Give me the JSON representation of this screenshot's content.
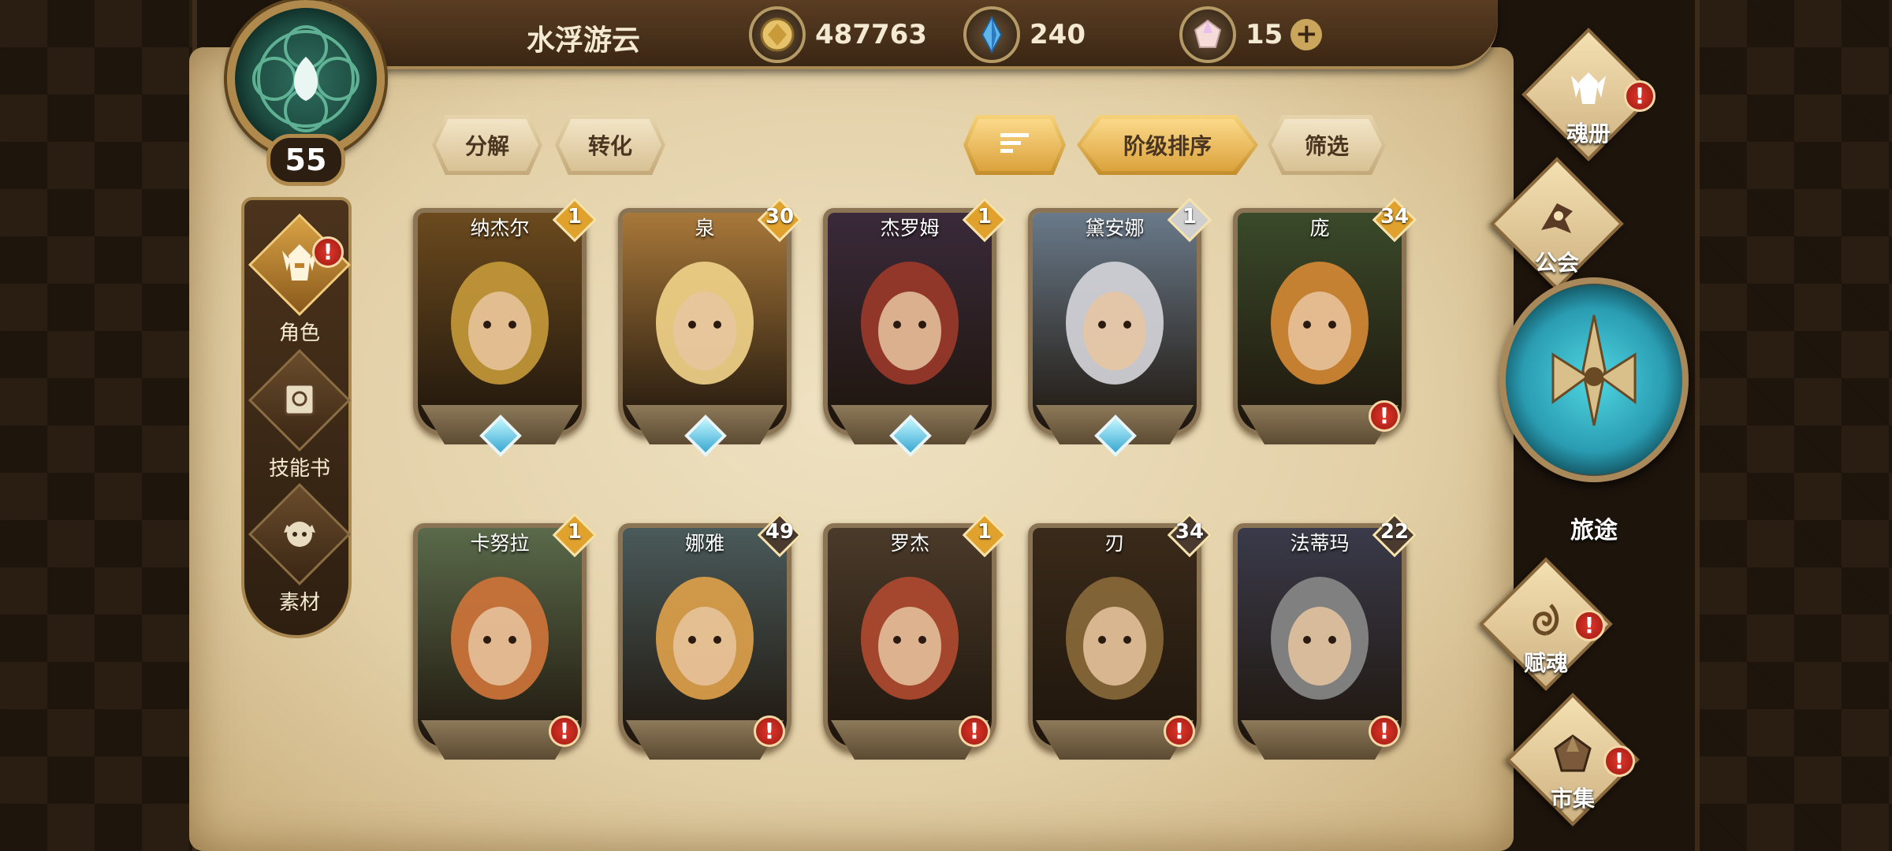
{
  "player": {
    "name": "水浮游云",
    "level": "55"
  },
  "resources": [
    {
      "icon": "gold-coin-icon",
      "value": "487763"
    },
    {
      "icon": "blue-crystal-icon",
      "value": "240"
    },
    {
      "icon": "pink-gem-icon",
      "value": "15"
    }
  ],
  "toolbar": {
    "decompose": "分解",
    "convert": "转化",
    "sort_order": "阶级排序",
    "filter": "筛选"
  },
  "left_nav": [
    {
      "label": "角色",
      "active": true,
      "alert": "!"
    },
    {
      "label": "技能书",
      "active": false
    },
    {
      "label": "素材",
      "active": false
    }
  ],
  "right_nav": {
    "soul_book": "魂册",
    "guild": "公会",
    "journey": "旅途",
    "soul_grant": "赋魂",
    "market": "市集",
    "alert": "!"
  },
  "heroes": [
    {
      "name": "纳杰尔",
      "rank": "1",
      "rank_color": "#e0a22c",
      "gem": true,
      "alert": false,
      "palette": [
        "#c79a3a",
        "#6b4a1e"
      ]
    },
    {
      "name": "泉",
      "rank": "30",
      "rank_color": "#e0a22c",
      "gem": true,
      "alert": false,
      "palette": [
        "#f2d48a",
        "#a8783a"
      ]
    },
    {
      "name": "杰罗姆",
      "rank": "1",
      "rank_color": "#e0a22c",
      "gem": true,
      "alert": false,
      "palette": [
        "#9c3a2a",
        "#3a2a3a"
      ]
    },
    {
      "name": "黛安娜",
      "rank": "1",
      "rank_color": "#cfcfcf",
      "gem": true,
      "alert": false,
      "palette": [
        "#d6d6dc",
        "#6a7a8a"
      ]
    },
    {
      "name": "庞",
      "rank": "34",
      "rank_color": "#e0a22c",
      "gem": false,
      "alert": true,
      "palette": [
        "#d68a34",
        "#3a4a2a"
      ]
    },
    {
      "name": "卡努拉",
      "rank": "1",
      "rank_color": "#e0a22c",
      "gem": false,
      "alert": true,
      "palette": [
        "#d0743a",
        "#5a6a4a"
      ]
    },
    {
      "name": "娜雅",
      "rank": "49",
      "rank_color": "#4a3a30",
      "gem": false,
      "alert": true,
      "palette": [
        "#e0a24a",
        "#4a5a5a"
      ]
    },
    {
      "name": "罗杰",
      "rank": "1",
      "rank_color": "#e0a22c",
      "gem": false,
      "alert": true,
      "palette": [
        "#b04a30",
        "#4a3a2a"
      ]
    },
    {
      "name": "刃",
      "rank": "34",
      "rank_color": "#4a3a30",
      "gem": false,
      "alert": true,
      "palette": [
        "#8a6a3a",
        "#3a2a1a"
      ]
    },
    {
      "name": "法蒂玛",
      "rank": "22",
      "rank_color": "#4a3a30",
      "gem": false,
      "alert": true,
      "palette": [
        "#8a8a8a",
        "#3a3a4a"
      ]
    }
  ]
}
